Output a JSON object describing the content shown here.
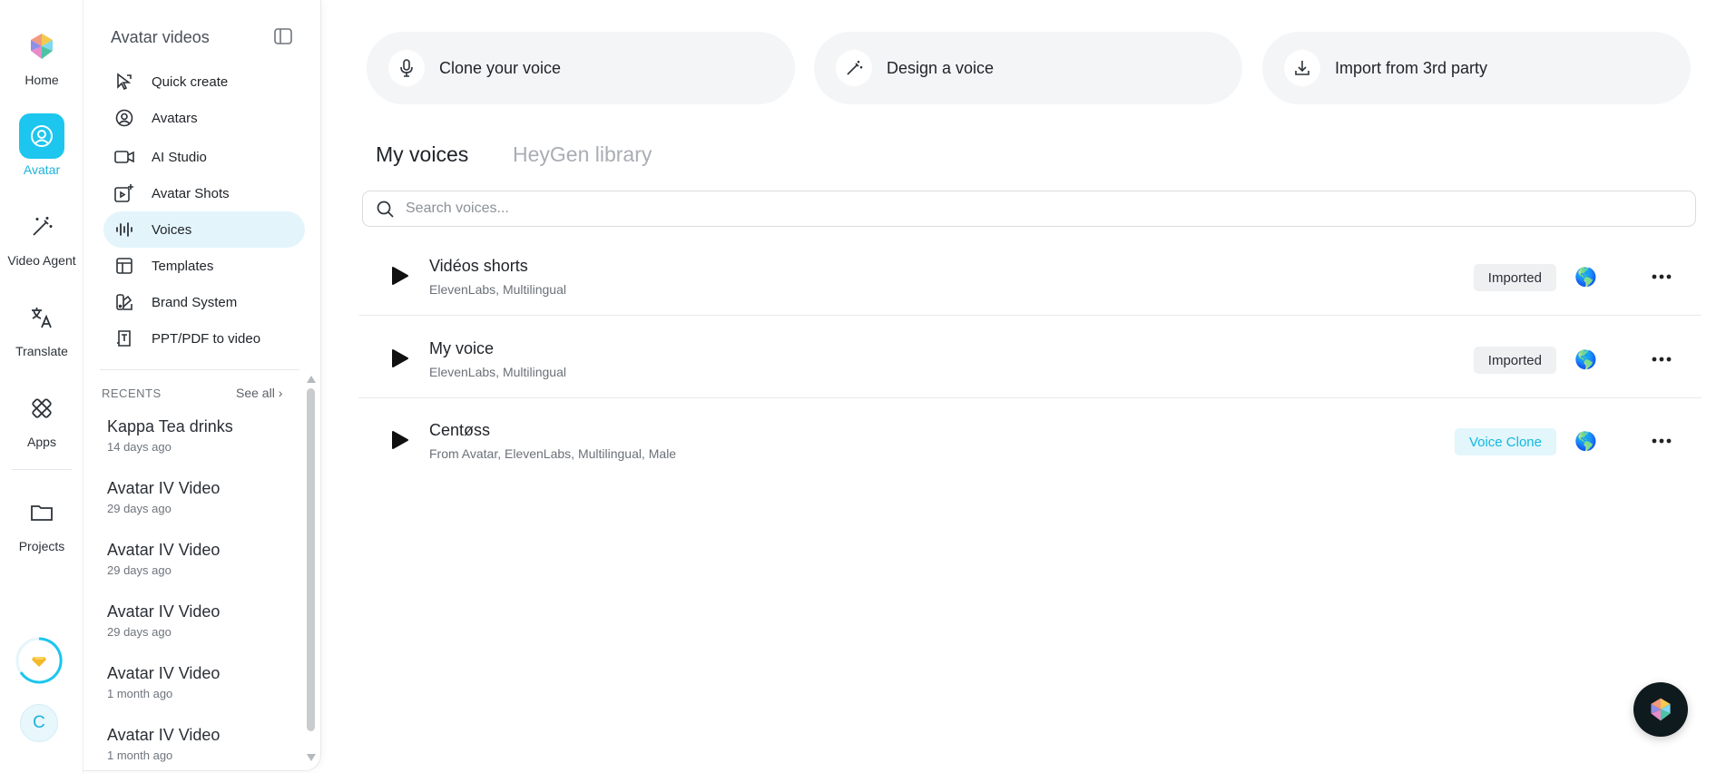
{
  "rail": {
    "items": [
      {
        "label": "Home",
        "icon": "heygen-logo-icon"
      },
      {
        "label": "Avatar",
        "icon": "avatar-icon"
      },
      {
        "label": "Video Agent",
        "icon": "magic-wand-icon"
      },
      {
        "label": "Translate",
        "icon": "translate-icon"
      },
      {
        "label": "Apps",
        "icon": "apps-icon"
      },
      {
        "label": "Projects",
        "icon": "folder-icon"
      }
    ],
    "user_initial": "C",
    "accent_color": "#1cc6ee"
  },
  "panel": {
    "title": "Avatar videos",
    "nav": [
      {
        "label": "Quick create",
        "icon": "cursor-icon"
      },
      {
        "label": "Avatars",
        "icon": "user-circle-icon"
      },
      {
        "label": "AI Studio",
        "icon": "video-camera-icon"
      },
      {
        "label": "Avatar Shots",
        "icon": "video-plus-icon"
      },
      {
        "label": "Voices",
        "icon": "waveform-icon"
      },
      {
        "label": "Templates",
        "icon": "layout-icon"
      },
      {
        "label": "Brand System",
        "icon": "palette-icon"
      },
      {
        "label": "PPT/PDF to video",
        "icon": "document-text-icon"
      }
    ],
    "recents_label": "RECENTS",
    "see_all": "See all ›",
    "recents": [
      {
        "title": "Kappa Tea drinks",
        "time": "14 days ago"
      },
      {
        "title": "Avatar IV Video",
        "time": "29 days ago"
      },
      {
        "title": "Avatar IV Video",
        "time": "29 days ago"
      },
      {
        "title": "Avatar IV Video",
        "time": "29 days ago"
      },
      {
        "title": "Avatar IV Video",
        "time": "1 month ago"
      },
      {
        "title": "Avatar IV Video",
        "time": "1 month ago"
      }
    ]
  },
  "actions": [
    {
      "label": "Clone your voice",
      "icon": "microphone-icon"
    },
    {
      "label": "Design a voice",
      "icon": "magic-wand-icon"
    },
    {
      "label": "Import from 3rd party",
      "icon": "download-icon"
    }
  ],
  "tabs": {
    "my_voices": "My voices",
    "library": "HeyGen library"
  },
  "search": {
    "placeholder": "Search voices..."
  },
  "voices": [
    {
      "name": "Vidéos shorts",
      "meta": "ElevenLabs, Multilingual",
      "badge": "Imported",
      "badge_type": "imported"
    },
    {
      "name": "My voice",
      "meta": "ElevenLabs, Multilingual",
      "badge": "Imported",
      "badge_type": "imported"
    },
    {
      "name": "Centøss",
      "meta": "From Avatar, ElevenLabs, Multilingual, Male",
      "badge": "Voice Clone",
      "badge_type": "clone"
    }
  ],
  "globe_glyph": "🌎"
}
